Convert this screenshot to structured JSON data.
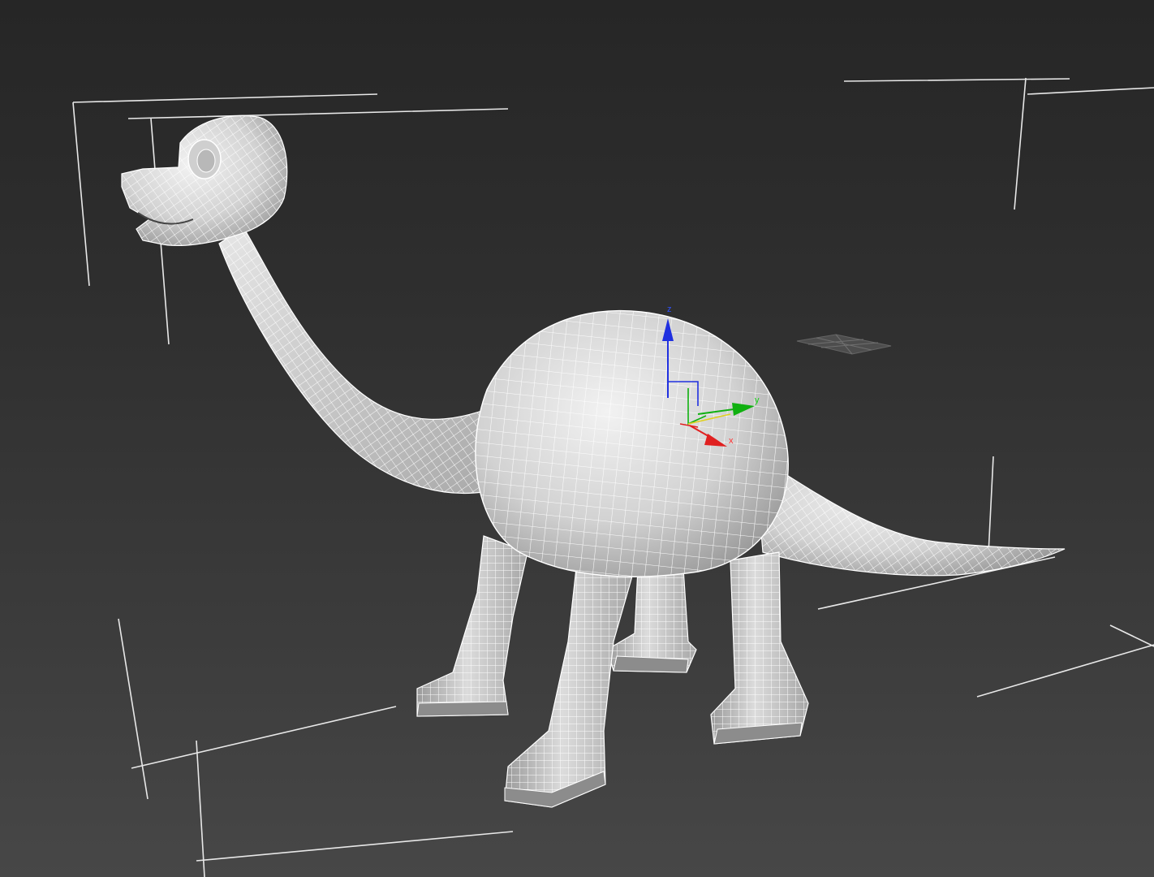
{
  "viewport": {
    "background": "#2e2e2e",
    "model": "dinosaur-wireframe-mesh",
    "mesh_color": "#d9d9d9",
    "wire_color": "#ffffff",
    "selection_bracket_color": "#ffffff"
  },
  "gizmo": {
    "type": "move-transform-gizmo",
    "axes": {
      "x": {
        "label": "x",
        "color": "#e02020"
      },
      "y": {
        "label": "y",
        "color": "#10b010"
      },
      "z": {
        "label": "z",
        "color": "#2030e0"
      }
    }
  }
}
